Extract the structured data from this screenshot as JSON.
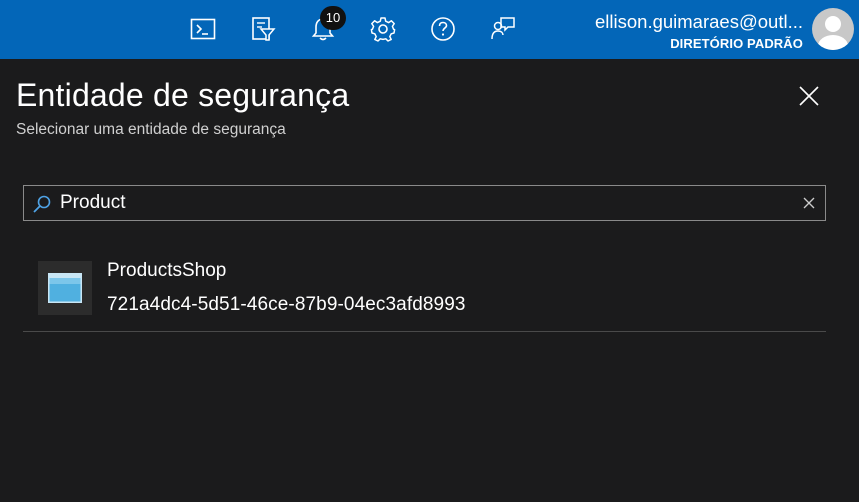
{
  "topbar": {
    "icons": [
      {
        "name": "cloud-shell-icon"
      },
      {
        "name": "directory-filter-icon"
      },
      {
        "name": "notifications-icon"
      },
      {
        "name": "settings-icon"
      },
      {
        "name": "help-icon"
      },
      {
        "name": "feedback-icon"
      }
    ],
    "notification_count": "10",
    "account": {
      "email": "ellison.guimaraes@outl...",
      "directory": "DIRETÓRIO PADRÃO"
    },
    "colors": {
      "background": "#0366b8"
    }
  },
  "panel": {
    "title": "Entidade de segurança",
    "subtitle": "Selecionar uma entidade de segurança",
    "search": {
      "value": "Product",
      "placeholder": ""
    },
    "results": [
      {
        "name": "ProductsShop",
        "id": "721a4dc4-5d51-46ce-87b9-04ec3afd8993",
        "icon": "app-window-icon"
      }
    ]
  }
}
